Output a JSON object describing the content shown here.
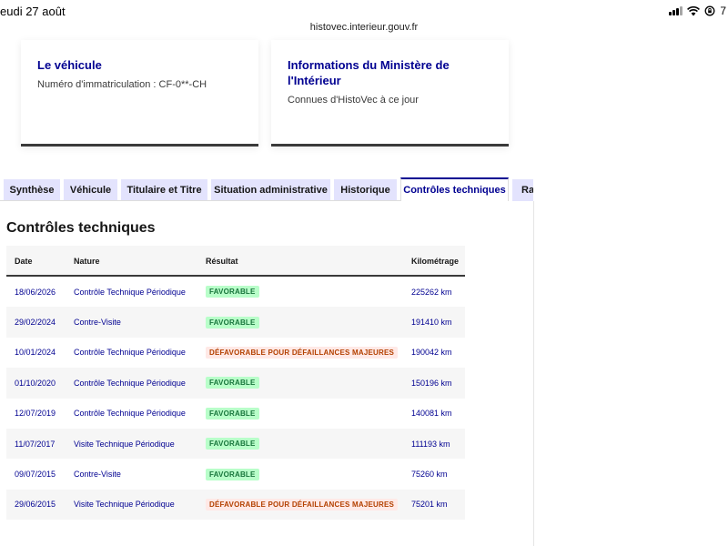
{
  "status_bar": {
    "time_date": "eudi 27 août",
    "battery_fragment": "7"
  },
  "browser": {
    "url": "histovec.interieur.gouv.fr"
  },
  "cards": [
    {
      "title": "Le véhicule",
      "text": "Numéro d'immatriculation : CF-0**-CH"
    },
    {
      "title": "Informations du Ministère de l'Intérieur",
      "text": "Connues d'HistoVec à ce jour"
    }
  ],
  "tabs": [
    {
      "label": "Synthèse",
      "active": false
    },
    {
      "label": "Véhicule",
      "active": false
    },
    {
      "label": "Titulaire et Titre",
      "active": false
    },
    {
      "label": "Situation administrative",
      "active": false
    },
    {
      "label": "Historique",
      "active": false
    },
    {
      "label": "Contrôles techniques",
      "active": true
    },
    {
      "label": "Rap",
      "active": false
    }
  ],
  "section": {
    "title": "Contrôles techniques"
  },
  "table": {
    "headers": {
      "date": "Date",
      "nature": "Nature",
      "result": "Résultat",
      "km": "Kilométrage"
    },
    "rows": [
      {
        "date": "18/06/2026",
        "nature": "Contrôle Technique Périodique",
        "result": "FAVORABLE",
        "status": "favorable",
        "km": "225262 km"
      },
      {
        "date": "29/02/2024",
        "nature": "Contre-Visite",
        "result": "FAVORABLE",
        "status": "favorable",
        "km": "191410 km"
      },
      {
        "date": "10/01/2024",
        "nature": "Contrôle Technique Périodique",
        "result": "DÉFAVORABLE POUR DÉFAILLANCES MAJEURES",
        "status": "defavorable",
        "km": "190042 km"
      },
      {
        "date": "01/10/2020",
        "nature": "Contrôle Technique Périodique",
        "result": "FAVORABLE",
        "status": "favorable",
        "km": "150196 km"
      },
      {
        "date": "12/07/2019",
        "nature": "Contrôle Technique Périodique",
        "result": "FAVORABLE",
        "status": "favorable",
        "km": "140081 km"
      },
      {
        "date": "11/07/2017",
        "nature": "Visite Technique Périodique",
        "result": "FAVORABLE",
        "status": "favorable",
        "km": "111193 km"
      },
      {
        "date": "09/07/2015",
        "nature": "Contre-Visite",
        "result": "FAVORABLE",
        "status": "favorable",
        "km": "75260 km"
      },
      {
        "date": "29/06/2015",
        "nature": "Visite Technique Périodique",
        "result": "DÉFAVORABLE POUR DÉFAILLANCES MAJEURES",
        "status": "defavorable",
        "km": "75201 km"
      }
    ]
  },
  "colors": {
    "brand_blue": "#000091",
    "tab_bg": "#e3e3fd",
    "favorable_bg": "#b8fec9",
    "favorable_text": "#18753c",
    "defavorable_bg": "#ffe9e6",
    "defavorable_text": "#b34000"
  }
}
